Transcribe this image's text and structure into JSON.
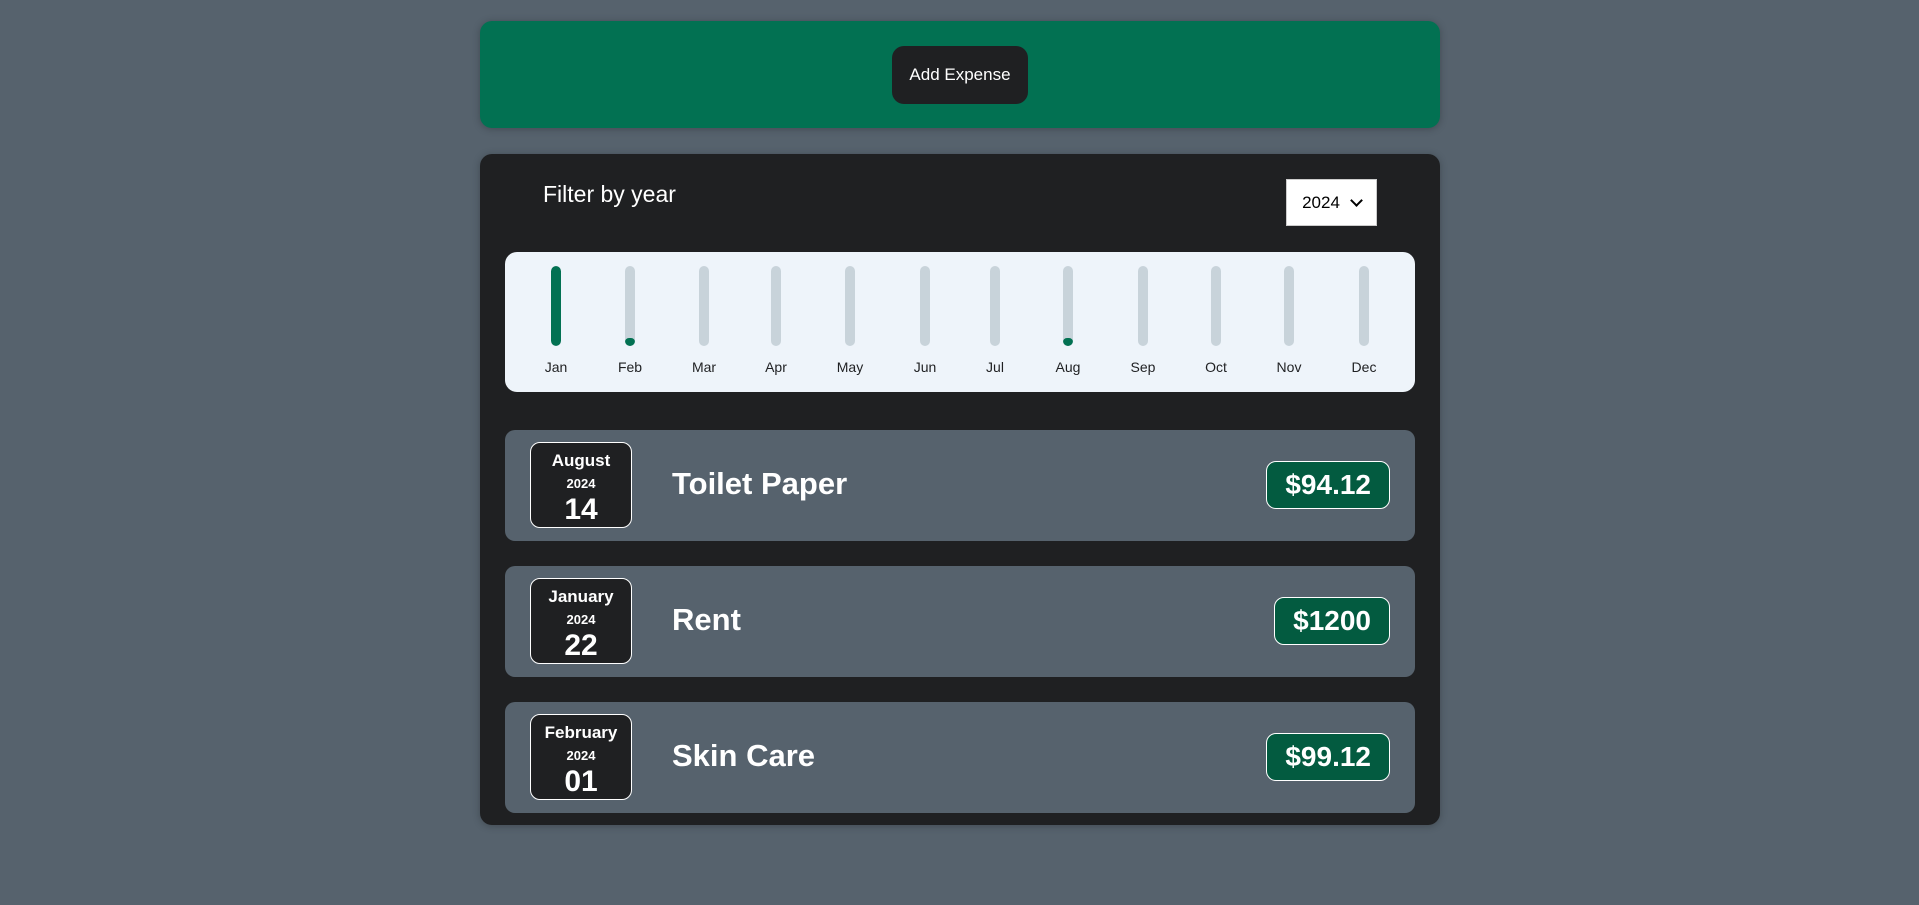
{
  "new_expense": {
    "add_button_label": "Add Expense"
  },
  "filter": {
    "label": "Filter by year",
    "selected_year": "2024"
  },
  "chart_data": {
    "type": "bar",
    "categories": [
      "Jan",
      "Feb",
      "Mar",
      "Apr",
      "May",
      "Jun",
      "Jul",
      "Aug",
      "Sep",
      "Oct",
      "Nov",
      "Dec"
    ],
    "values": [
      1200,
      99.12,
      0,
      0,
      0,
      0,
      0,
      94.12,
      0,
      0,
      0,
      0
    ],
    "ylim": [
      0,
      1200
    ],
    "fill_color": "#027152",
    "track_color": "#c8d3da"
  },
  "expenses": [
    {
      "month": "August",
      "year": "2024",
      "day": "14",
      "title": "Toilet Paper",
      "amount": "$94.12"
    },
    {
      "month": "January",
      "year": "2024",
      "day": "22",
      "title": "Rent",
      "amount": "$1200"
    },
    {
      "month": "February",
      "year": "2024",
      "day": "01",
      "title": "Skin Care",
      "amount": "$99.12"
    }
  ],
  "colors": {
    "background": "#56626d",
    "accent": "#027152",
    "card": "#1f2022",
    "price_badge": "#035b40"
  }
}
